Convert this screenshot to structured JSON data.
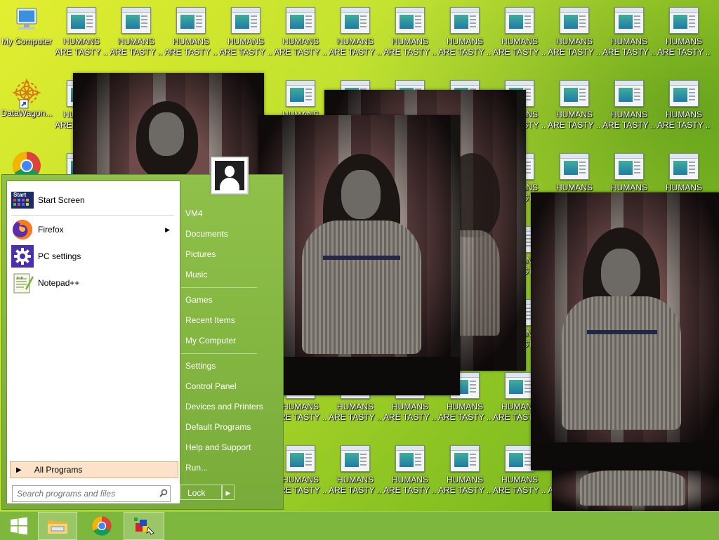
{
  "desktop": {
    "my_computer_label": "My Computer",
    "datawagon_label": "DataWagon...",
    "chrome_label": "",
    "file_icon_line1": "HUMANS",
    "file_icon_line2": "ARE TASTY ..."
  },
  "start_menu": {
    "pinned": [
      {
        "label": "Start Screen",
        "icon": "start-screen-icon",
        "icon_text": "Start"
      },
      {
        "label": "Firefox",
        "icon": "firefox-icon",
        "has_submenu": true
      },
      {
        "label": "PC settings",
        "icon": "gear-icon"
      },
      {
        "label": "Notepad++",
        "icon": "notepad-plus-plus-icon"
      }
    ],
    "all_programs": "All Programs",
    "search_placeholder": "Search programs and files",
    "right_items": [
      {
        "label": "VM4"
      },
      {
        "label": "Documents"
      },
      {
        "label": "Pictures"
      },
      {
        "label": "Music"
      },
      {
        "label": "Games"
      },
      {
        "label": "Recent Items"
      },
      {
        "label": "My Computer"
      },
      {
        "label": "Settings"
      },
      {
        "label": "Control Panel"
      },
      {
        "label": "Devices and Printers"
      },
      {
        "label": "Default Programs"
      },
      {
        "label": "Help and Support"
      },
      {
        "label": "Run..."
      }
    ],
    "lock_label": "Lock"
  },
  "taskbar": {
    "buttons": [
      {
        "name": "windows-start-icon"
      },
      {
        "name": "file-explorer-icon"
      },
      {
        "name": "chrome-icon"
      },
      {
        "name": "paint-app-icon"
      }
    ]
  },
  "colors": {
    "desktop_green": "#b9de2a",
    "start_menu_green": "#8fc14a",
    "taskbar_green": "#7eb73d",
    "all_programs_highlight": "#fbe2c9"
  }
}
